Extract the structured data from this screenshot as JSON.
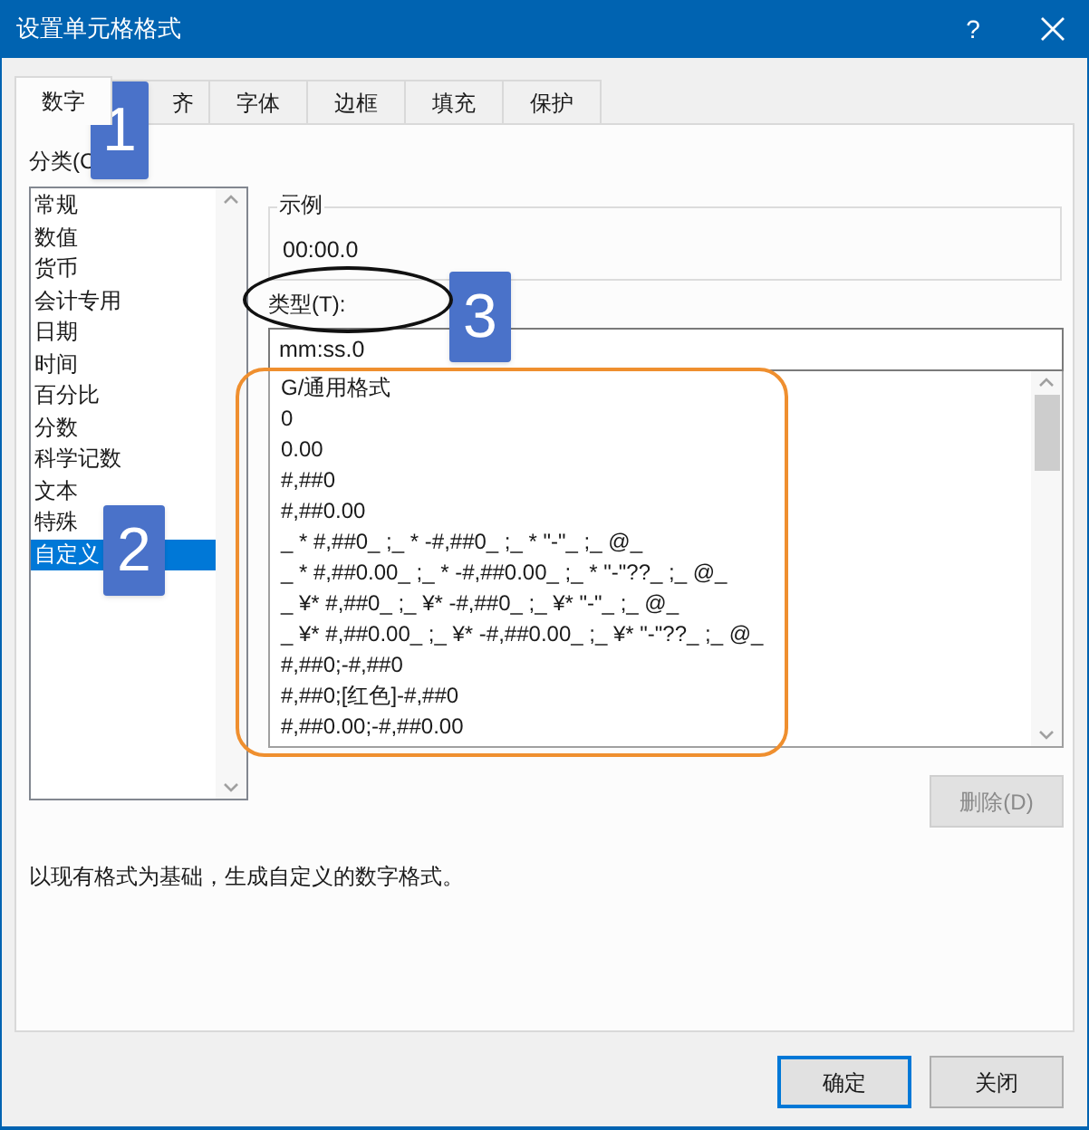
{
  "window": {
    "title": "设置单元格格式",
    "help": "?"
  },
  "tabs": [
    {
      "label": "数字",
      "selected": true
    },
    {
      "label": "齐",
      "selected": false
    },
    {
      "label": "字体",
      "selected": false
    },
    {
      "label": "边框",
      "selected": false
    },
    {
      "label": "填充",
      "selected": false
    },
    {
      "label": "保护",
      "selected": false
    }
  ],
  "category": {
    "label": "分类(C",
    "items": [
      {
        "label": "常规",
        "selected": false
      },
      {
        "label": "数值",
        "selected": false
      },
      {
        "label": "货币",
        "selected": false
      },
      {
        "label": "会计专用",
        "selected": false
      },
      {
        "label": "日期",
        "selected": false
      },
      {
        "label": "时间",
        "selected": false
      },
      {
        "label": "百分比",
        "selected": false
      },
      {
        "label": "分数",
        "selected": false
      },
      {
        "label": "科学记数",
        "selected": false
      },
      {
        "label": "文本",
        "selected": false
      },
      {
        "label": "特殊",
        "selected": false
      },
      {
        "label": "自定义",
        "selected": true
      }
    ]
  },
  "sample": {
    "label": "示例",
    "value": "00:00.0"
  },
  "type_field": {
    "label": "类型(T):",
    "value": "mm:ss.0"
  },
  "formats": [
    "G/通用格式",
    "0",
    "0.00",
    "#,##0",
    "#,##0.00",
    "_ * #,##0_ ;_ * -#,##0_ ;_ * \"-\"_ ;_ @_",
    "_ * #,##0.00_ ;_ * -#,##0.00_ ;_ * \"-\"??_ ;_ @_",
    "_ ¥* #,##0_ ;_ ¥* -#,##0_ ;_ ¥* \"-\"_ ;_ @_",
    "_ ¥* #,##0.00_ ;_ ¥* -#,##0.00_ ;_ ¥* \"-\"??_ ;_ @_",
    "#,##0;-#,##0",
    "#,##0;[红色]-#,##0",
    "#,##0.00;-#,##0.00"
  ],
  "delete_button": {
    "label": "删除(D)",
    "disabled": true
  },
  "description": "以现有格式为基础，生成自定义的数字格式。",
  "buttons": [
    {
      "label": "确定",
      "default": true
    },
    {
      "label": "关闭",
      "default": false
    }
  ],
  "annotations": [
    {
      "kind": "badge",
      "label": "1"
    },
    {
      "kind": "badge",
      "label": "2"
    },
    {
      "kind": "badge",
      "label": "3"
    },
    {
      "kind": "ellipse",
      "color": "#111111"
    },
    {
      "kind": "outline",
      "color": "#ef8f2f"
    }
  ]
}
